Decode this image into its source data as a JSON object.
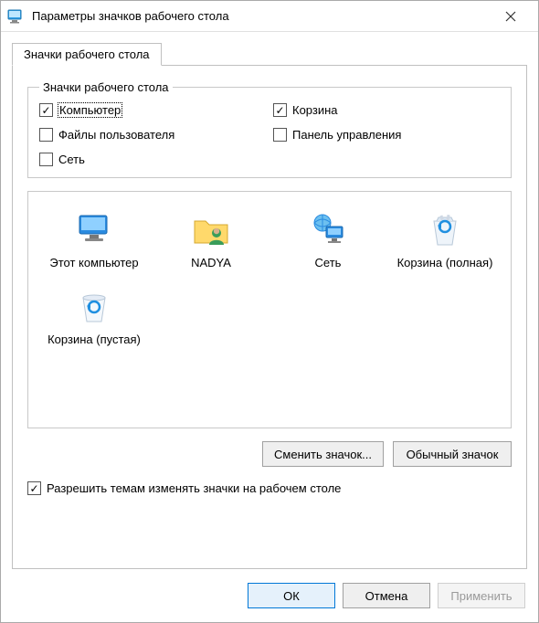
{
  "window": {
    "title": "Параметры значков рабочего стола"
  },
  "tab": {
    "label": "Значки рабочего стола"
  },
  "group": {
    "legend": "Значки рабочего стола",
    "checkboxes": {
      "computer": {
        "label": "Компьютер",
        "checked": true,
        "focused": true
      },
      "recycle": {
        "label": "Корзина",
        "checked": true
      },
      "userfiles": {
        "label": "Файлы пользователя",
        "checked": false
      },
      "ctrlpanel": {
        "label": "Панель управления",
        "checked": false
      },
      "network": {
        "label": "Сеть",
        "checked": false
      }
    }
  },
  "icons": {
    "this_pc": {
      "label": "Этот компьютер"
    },
    "user": {
      "label": "NADYA"
    },
    "network": {
      "label": "Сеть"
    },
    "bin_full": {
      "label": "Корзина (полная)"
    },
    "bin_empty": {
      "label": "Корзина (пустая)"
    }
  },
  "buttons": {
    "change_icon": "Сменить значок...",
    "default_icon": "Обычный значок"
  },
  "allow_themes": {
    "label": "Разрешить темам изменять значки на рабочем столе",
    "checked": true
  },
  "footer": {
    "ok": "ОК",
    "cancel": "Отмена",
    "apply": "Применить"
  }
}
